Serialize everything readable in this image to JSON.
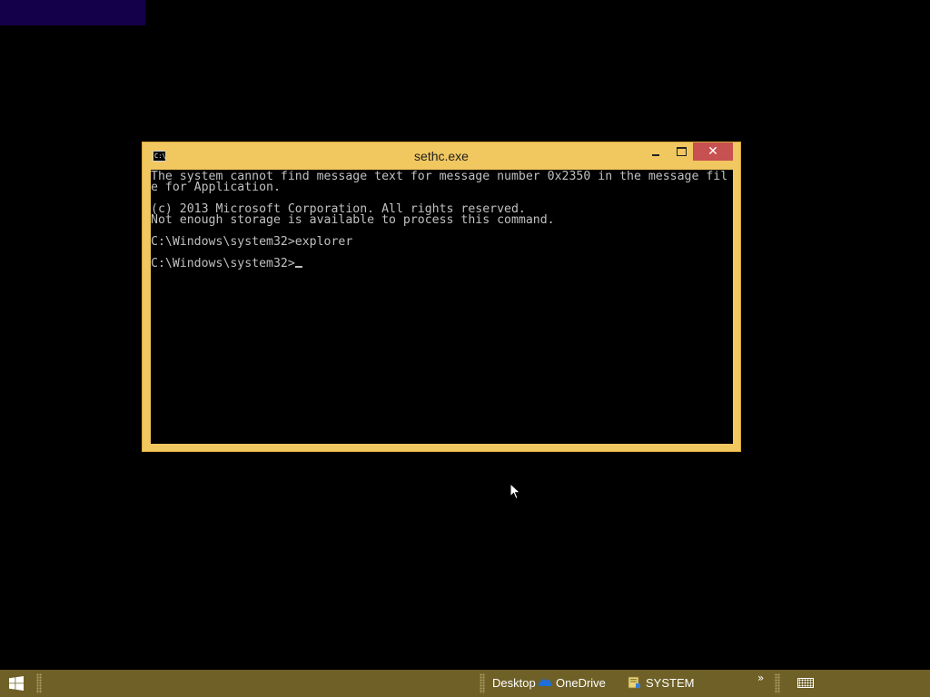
{
  "window": {
    "title": "sethc.exe",
    "icon_label": "C:\\.",
    "close_symbol": "✕"
  },
  "console": {
    "lines": [
      "The system cannot find message text for message number 0x2350 in the message fil",
      "e for Application.",
      "",
      "(c) 2013 Microsoft Corporation. All rights reserved.",
      "Not enough storage is available to process this command.",
      "",
      "C:\\Windows\\system32>explorer",
      "",
      "C:\\Windows\\system32>"
    ]
  },
  "taskbar": {
    "desktop_label": "Desktop",
    "onedrive_label": "OneDrive",
    "system_label": "SYSTEM",
    "chevron": "»"
  },
  "colors": {
    "window_frame": "#f1c75f",
    "close_button": "#c75050",
    "taskbar": "#6e6027",
    "corner_block": "#14004a"
  },
  "icons": [
    "cmd-icon",
    "windows-logo-icon",
    "onedrive-cloud-icon",
    "folder-icon",
    "keyboard-icon",
    "mouse-pointer-icon"
  ]
}
